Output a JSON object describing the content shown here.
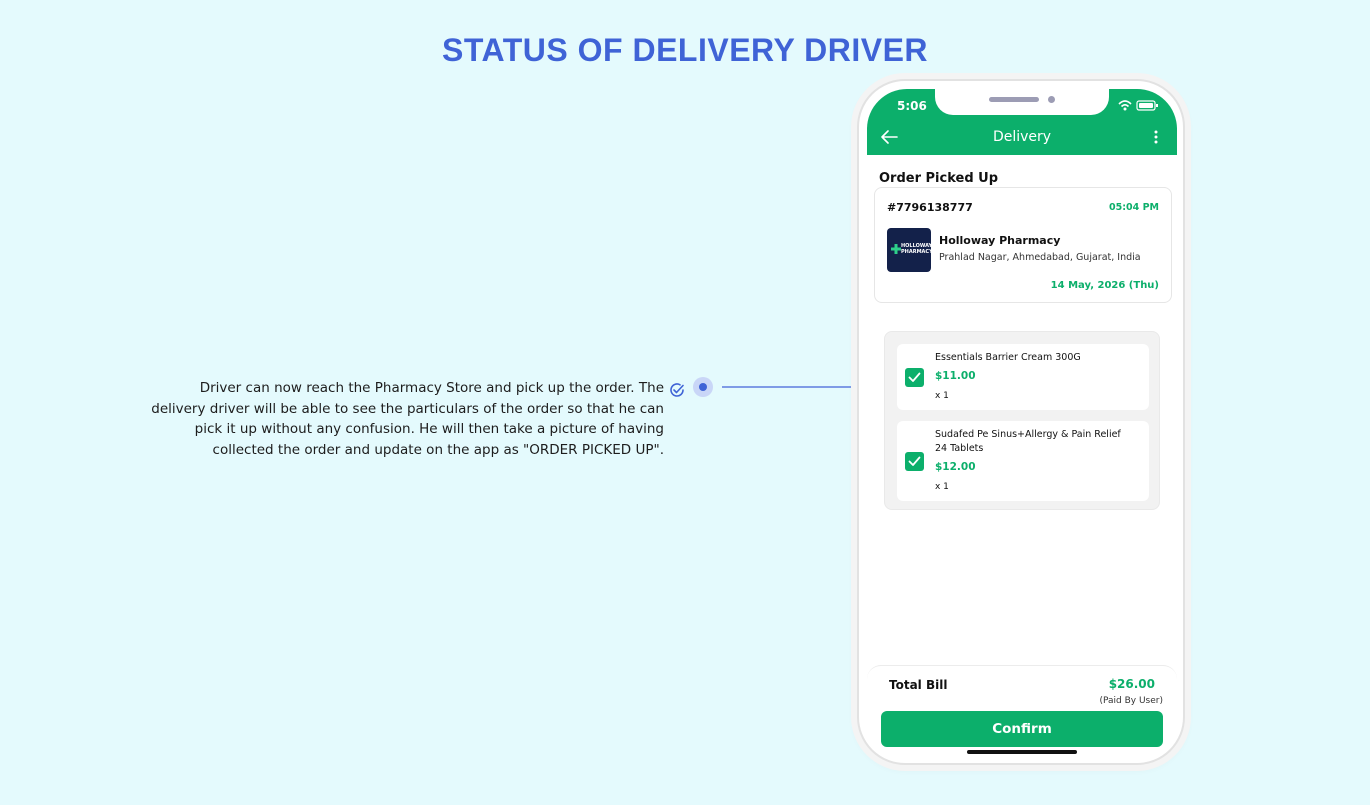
{
  "page": {
    "title": "STATUS OF DELIVERY DRIVER",
    "description": "Driver can now reach the Pharmacy Store and pick up the order. The delivery driver will be able to see the particulars of the order so that he can pick it up without any confusion. He will then take a picture of having collected the order and update on the app as \"ORDER PICKED UP\"."
  },
  "colors": {
    "accent": "#0caf6b",
    "title_blue": "#3f63d6",
    "background": "#e4fafd"
  },
  "phone": {
    "status_bar": {
      "time": "5:06",
      "icons": [
        "wifi-icon",
        "battery-icon"
      ]
    },
    "header": {
      "title": "Delivery",
      "back_icon": "arrow-left-icon",
      "menu_icon": "more-vertical-icon"
    },
    "section_title": "Order Picked Up",
    "order": {
      "id": "#7796138777",
      "time": "05:04 PM",
      "store_logo_text": "HOLLOWAY PHARMACY",
      "store_name": "Holloway Pharmacy",
      "store_address": "Prahlad Nagar, Ahmedabad, Gujarat, India",
      "date": "14 May, 2026 (Thu)"
    },
    "items": [
      {
        "name": "Essentials Barrier Cream 300G",
        "price": "$11.00",
        "qty": "x 1",
        "checked": true
      },
      {
        "name": "Sudafed Pe Sinus+Allergy & Pain Relief 24 Tablets",
        "price": "$12.00",
        "qty": "x 1",
        "checked": true
      }
    ],
    "footer": {
      "total_label": "Total Bill",
      "total_value": "$26.00",
      "paid_by": "(Paid By User)",
      "confirm_label": "Confirm"
    }
  }
}
